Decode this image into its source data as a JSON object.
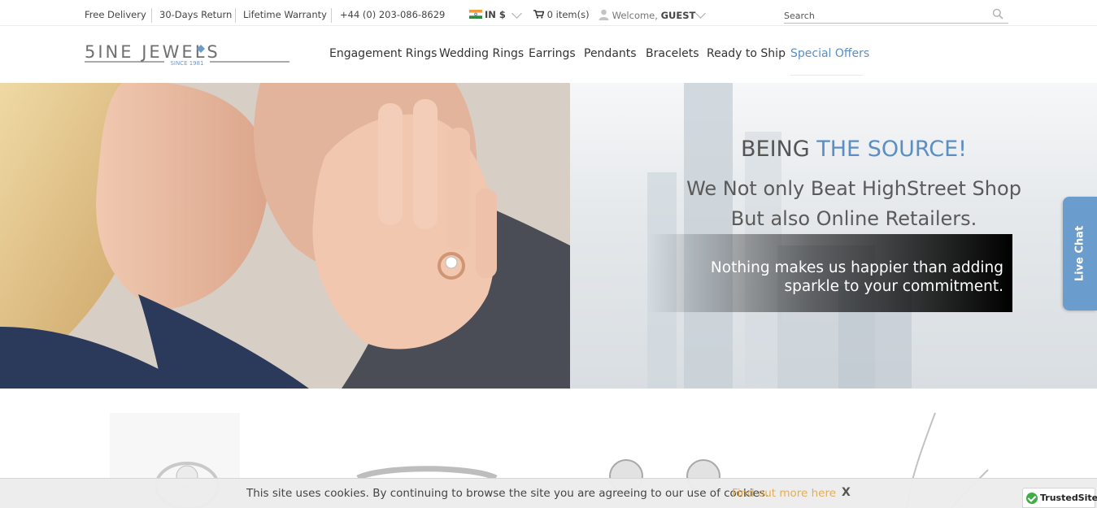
{
  "topbar": {
    "free_delivery": "Free Delivery",
    "returns": "30-Days Return",
    "warranty": "Lifetime Warranty",
    "phone": "+44 (0) 203-086-8629",
    "currency": "IN $",
    "cart": "0 item(s)",
    "welcome_prefix": "Welcome,",
    "welcome_user": "GUEST",
    "search_placeholder": "Search"
  },
  "header": {
    "logo_text": "5INE JEWELS",
    "logo_tagline": "SINCE 1981",
    "nav": [
      {
        "label": "Engagement Rings"
      },
      {
        "label": "Wedding Rings"
      },
      {
        "label": "Earrings"
      },
      {
        "label": "Pendants"
      },
      {
        "label": "Bracelets"
      },
      {
        "label": "Ready to Ship"
      },
      {
        "label": "Special Offers"
      }
    ]
  },
  "hero": {
    "title_main": "BEING ",
    "title_accent": "THE SOURCE!",
    "subtitle_line1": "We Not only Beat HighStreet Shop",
    "subtitle_line2": "But also Online Retailers.",
    "box_line1": "Nothing makes us happier than adding",
    "box_line2": "sparkle to your commitment."
  },
  "live_chat": "Live Chat",
  "cookie": {
    "text": "This site uses cookies. By continuing to browse the site you are agreeing to our use of cookies.",
    "link": "Find out more here",
    "close": "X"
  },
  "trusted_site": "TrustedSite",
  "colors": {
    "accent": "#5b8ec2",
    "cookie_link": "#e2ae57",
    "live_chat": "#6a9ccd"
  }
}
